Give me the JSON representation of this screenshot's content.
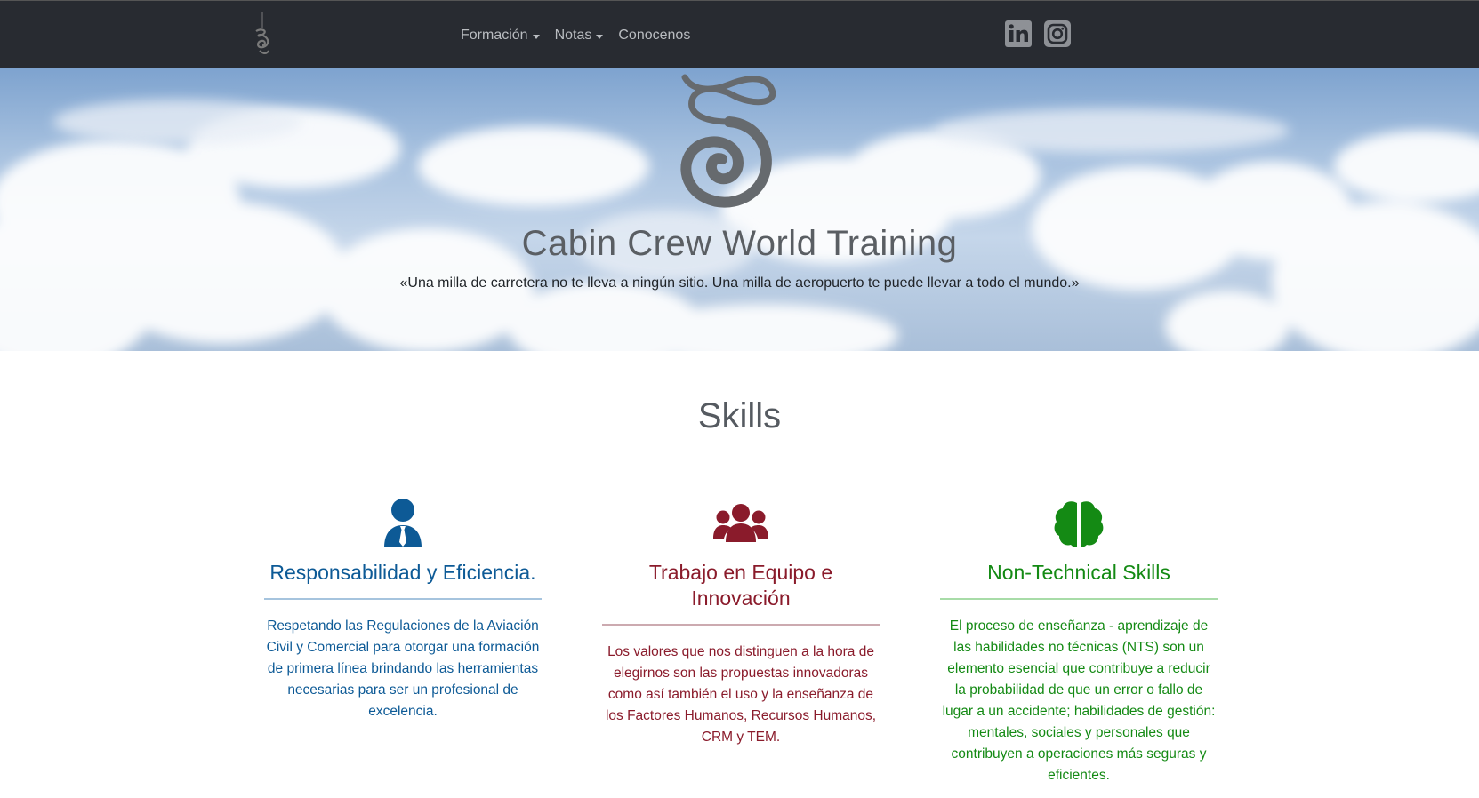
{
  "nav": {
    "items": [
      {
        "label": "Formación",
        "dropdown": true
      },
      {
        "label": "Notas",
        "dropdown": true
      },
      {
        "label": "Conocenos",
        "dropdown": false
      }
    ],
    "social": [
      "linkedin-icon",
      "instagram-icon"
    ]
  },
  "hero": {
    "title": "Cabin Crew World Training",
    "quote": "«Una milla de carretera no te lleva a ningún sitio. Una milla de aeropuerto te puede llevar a todo el mundo.»"
  },
  "skills": {
    "title": "Skills",
    "cards": [
      {
        "icon": "user-tie-icon",
        "color": "#0d5a96",
        "heading": "Responsabilidad y Eficiencia.",
        "text": "Respetando las Regulaciones de la Aviación Civil y Comercial para otorgar una formación de primera línea brindando las herramientas necesarias para ser un profesional de excelencia."
      },
      {
        "icon": "users-icon",
        "color": "#8a1b2b",
        "heading": "Trabajo en Equipo e Innovación",
        "text": "Los valores que nos distinguen a la hora de elegirnos son las propuestas innovadoras como así también el uso y la enseñanza de los Factores Humanos, Recursos Humanos, CRM y TEM."
      },
      {
        "icon": "brain-icon",
        "color": "#148a14",
        "heading": "Non-Technical Skills",
        "text": "El proceso de enseñanza - aprendizaje de las habilidades no técnicas (NTS) son un elemento esencial que contribuye a reducir la probabilidad de que un error o fallo de lugar a un accidente; habilidades de gestión: mentales, sociales y personales que contribuyen a operaciones más seguras y eficientes."
      }
    ]
  }
}
